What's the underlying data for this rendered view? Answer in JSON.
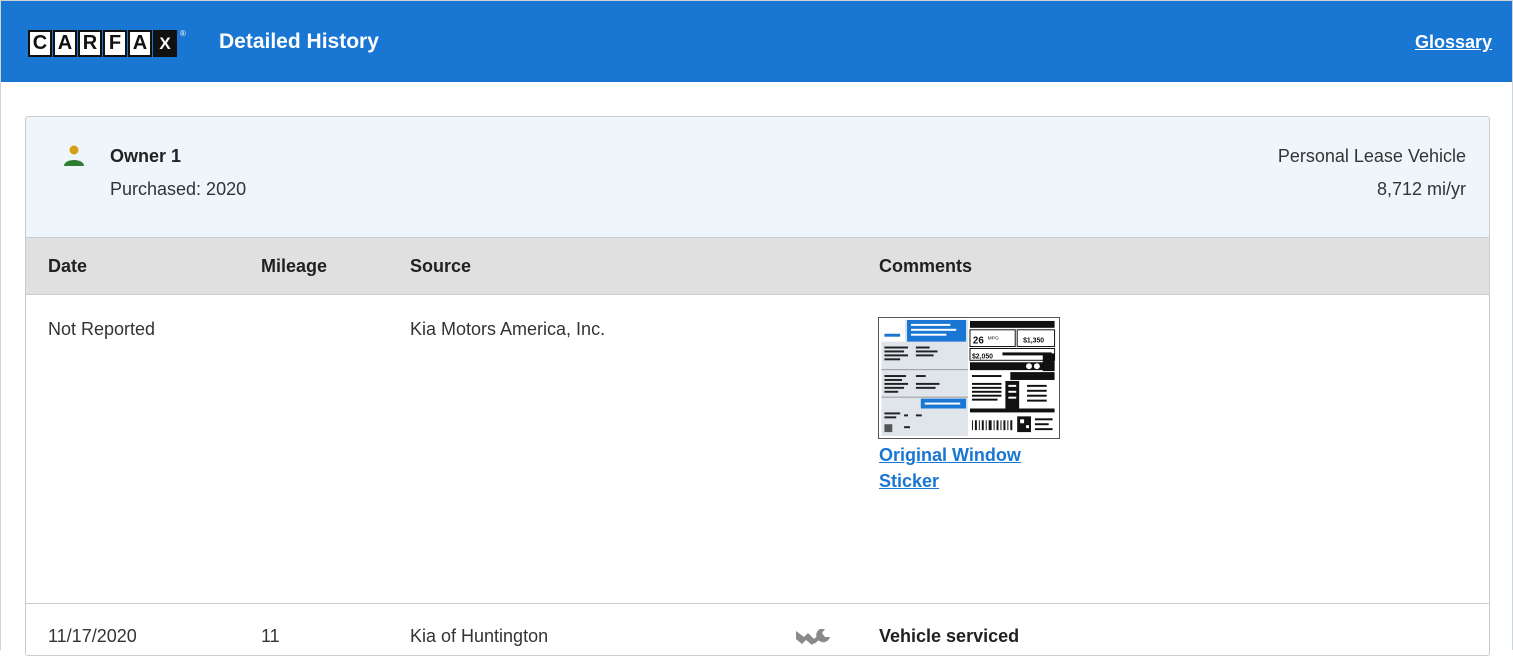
{
  "header": {
    "logo_letters": [
      "C",
      "A",
      "R",
      "F",
      "A",
      "X"
    ],
    "logo_mark": "®",
    "title": "Detailed History",
    "glossary_link": "Glossary",
    "bar_color": "#1976d2"
  },
  "owner": {
    "icon": "person-icon",
    "name": "Owner 1",
    "purchased": "Purchased: 2020",
    "type": "Personal Lease Vehicle",
    "miles_per_year": "8,712 mi/yr"
  },
  "table": {
    "columns": [
      "Date",
      "Mileage",
      "Source",
      "Comments"
    ],
    "rows": [
      {
        "date": "Not Reported",
        "mileage": "",
        "source": "Kia Motors America, Inc.",
        "comment_thumbnail": "window-sticker-thumbnail",
        "sticker_texts": [
          "26",
          "MPG",
          "$1,350",
          "$2,050"
        ],
        "comment_link": "Original Window Sticker"
      },
      {
        "date": "11/17/2020",
        "mileage": "11",
        "source": "Kia of Huntington",
        "icon": "wrench-icon",
        "comment": "Vehicle serviced"
      }
    ]
  },
  "colors": {
    "link": "#1976d2",
    "owner_bg": "#eef5fb",
    "header_row_bg": "#e0e0e0",
    "person_head": "#d4a017",
    "person_body": "#2e7d32"
  }
}
